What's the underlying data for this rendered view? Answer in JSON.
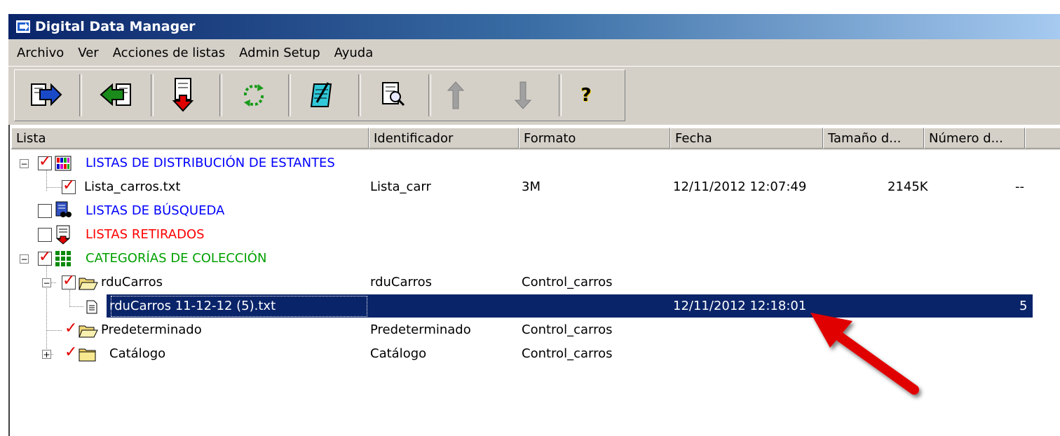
{
  "window": {
    "title": "Digital Data Manager"
  },
  "menu": [
    "Archivo",
    "Ver",
    "Acciones de listas",
    "Admin Setup",
    "Ayuda"
  ],
  "toolbar": {
    "buttons": [
      "export-icon",
      "import-icon",
      "download-icon",
      "refresh-icon",
      "edit-icon",
      "inspect-icon",
      "move-up-icon",
      "move-down-icon",
      "help-icon"
    ],
    "help_glyph": "?"
  },
  "columns": [
    "Lista",
    "Identificador",
    "Formato",
    "Fecha",
    "Tamaño d...",
    "Número d..."
  ],
  "rows": [
    {
      "name": "LISTAS DE DISTRIBUCIÓN DE ESTANTES",
      "color": "#0000ff",
      "checked": true
    },
    {
      "name": "Lista_carros.txt",
      "id": "Lista_carr",
      "format": "3M",
      "date": "12/11/2012 12:07:49",
      "size": "2145K",
      "count": "--",
      "checked": true
    },
    {
      "name": "LISTAS DE BÚSQUEDA",
      "color": "#0000ff",
      "checked": false
    },
    {
      "name": "LISTAS RETIRADOS",
      "color": "#ff0000",
      "checked": false
    },
    {
      "name": "CATEGORÍAS DE COLECCIÓN",
      "color": "#00a000",
      "checked": true
    },
    {
      "name": "rduCarros",
      "id": "rduCarros",
      "format": "Control_carros",
      "checked": true
    },
    {
      "name": "rduCarros 11-12-12 (5).txt",
      "date": "12/11/2012 12:18:01",
      "count": "5",
      "selected": true
    },
    {
      "name": "Predeterminado",
      "id": "Predeterminado",
      "format": "Control_carros"
    },
    {
      "name": "Catálogo",
      "id": "Catálogo",
      "format": "Control_carros"
    }
  ],
  "tree_glyphs": {
    "collapse": "−",
    "expand": "+",
    "check": "✓"
  },
  "annotation": {
    "type": "arrow",
    "color": "#e00000"
  }
}
